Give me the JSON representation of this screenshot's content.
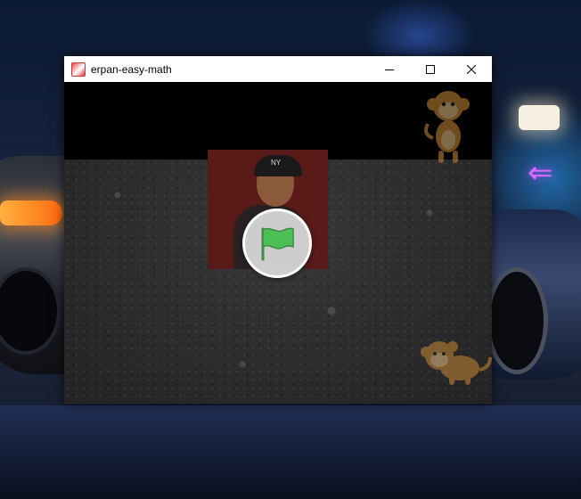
{
  "window": {
    "title": "erpan-easy-math",
    "controls": {
      "minimize_icon": "minimize-icon",
      "maximize_icon": "maximize-icon",
      "close_icon": "close-icon"
    }
  },
  "stage": {
    "player_cap_text": "NY",
    "start_button_icon": "green-flag-icon",
    "sprites": [
      "monkey-sprite",
      "monkey-sprite"
    ]
  },
  "colors": {
    "titlebar": "#ffffff",
    "flag_green": "#4cbf56",
    "card_red": "#5a1a18",
    "monkey_orange": "#c98a35"
  }
}
